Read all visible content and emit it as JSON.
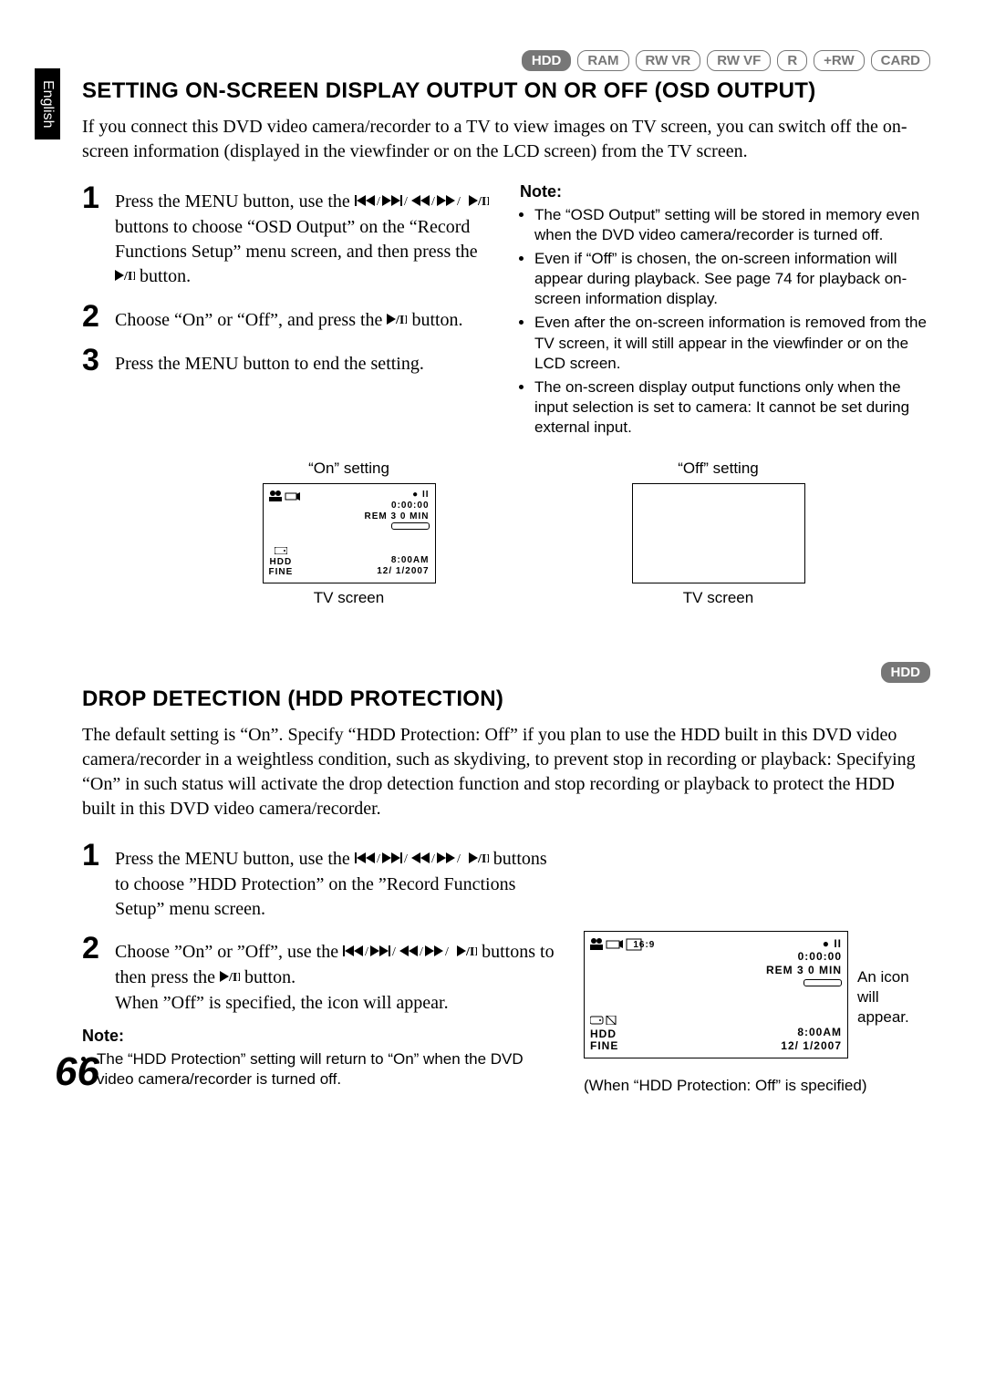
{
  "side_tab": "English",
  "badges1": [
    "HDD",
    "RAM",
    "RW VR",
    "RW VF",
    "R",
    "+RW",
    "CARD"
  ],
  "section1": {
    "title": "SETTING ON-SCREEN DISPLAY OUTPUT ON OR OFF (OSD OUTPUT)",
    "intro": "If you connect this DVD video camera/recorder to a TV to view images on TV screen, you can switch off the on-screen information (displayed in the viewfinder or on the LCD screen) from the TV screen.",
    "step1_a": "Press the MENU button, use the ",
    "step1_b": " buttons to choose “OSD Output” on the “Record Functions Setup” menu screen, and then press the ",
    "step1_c": " button.",
    "step2_a": "Choose “On” or “Off”, and press the ",
    "step2_b": " button.",
    "step3": "Press the MENU button to end the setting.",
    "note_head": "Note:",
    "notes": [
      "The “OSD Output” setting will be stored in memory even when the DVD video camera/recorder is turned off.",
      "Even if “Off” is chosen, the on-screen information will appear during playback. See page 74 for playback on-screen information display.",
      "Even after the on-screen information is removed from the TV screen, it will still appear in the viewfinder or on the LCD screen.",
      "The on-screen display output functions only when the input selection is set to camera: It cannot be set during external input."
    ],
    "on_label": "“On” setting",
    "off_label": "“Off” setting",
    "tv_screen": "TV screen",
    "osd": {
      "rec_time": "0:00:00",
      "rem": "REM 3 0 MIN",
      "clock": "8:00AM",
      "date": "12/ 1/2007",
      "hdd": "HDD",
      "fine": "FINE"
    }
  },
  "badges2": [
    "HDD"
  ],
  "section2": {
    "title": "DROP DETECTION (HDD PROTECTION)",
    "intro": "The default setting is “On”. Specify “HDD Protection: Off” if you plan to use the HDD built in this DVD video camera/recorder in a weightless condition, such as skydiving, to prevent stop in recording or playback: Specifying “On” in such status will activate the drop detection function and stop recording or playback to protect the HDD built in this DVD video camera/recorder.",
    "step1_a": "Press the MENU button, use the ",
    "step1_b": " buttons to choose ”HDD Protection” on the ”Record Functions Setup” menu screen.",
    "step2_a": "Choose ”On” or ”Off”, use the ",
    "step2_b": " buttons to then press the ",
    "step2_c": " button.",
    "step2_d": "When ”Off” is specified, the icon will appear.",
    "note_head": "Note:",
    "note1": "The “HDD Protection” setting will return to “On” when the DVD video camera/recorder is turned off.",
    "side_note": "An icon will appear.",
    "off_caption": "(When “HDD Protection: Off” is specified)",
    "osd": {
      "aspect": "16:9",
      "rec_time": "0:00:00",
      "rem": "REM 3 0 MIN",
      "clock": "8:00AM",
      "date": "12/ 1/2007",
      "hdd": "HDD",
      "fine": "FINE"
    }
  },
  "page_number": "66"
}
